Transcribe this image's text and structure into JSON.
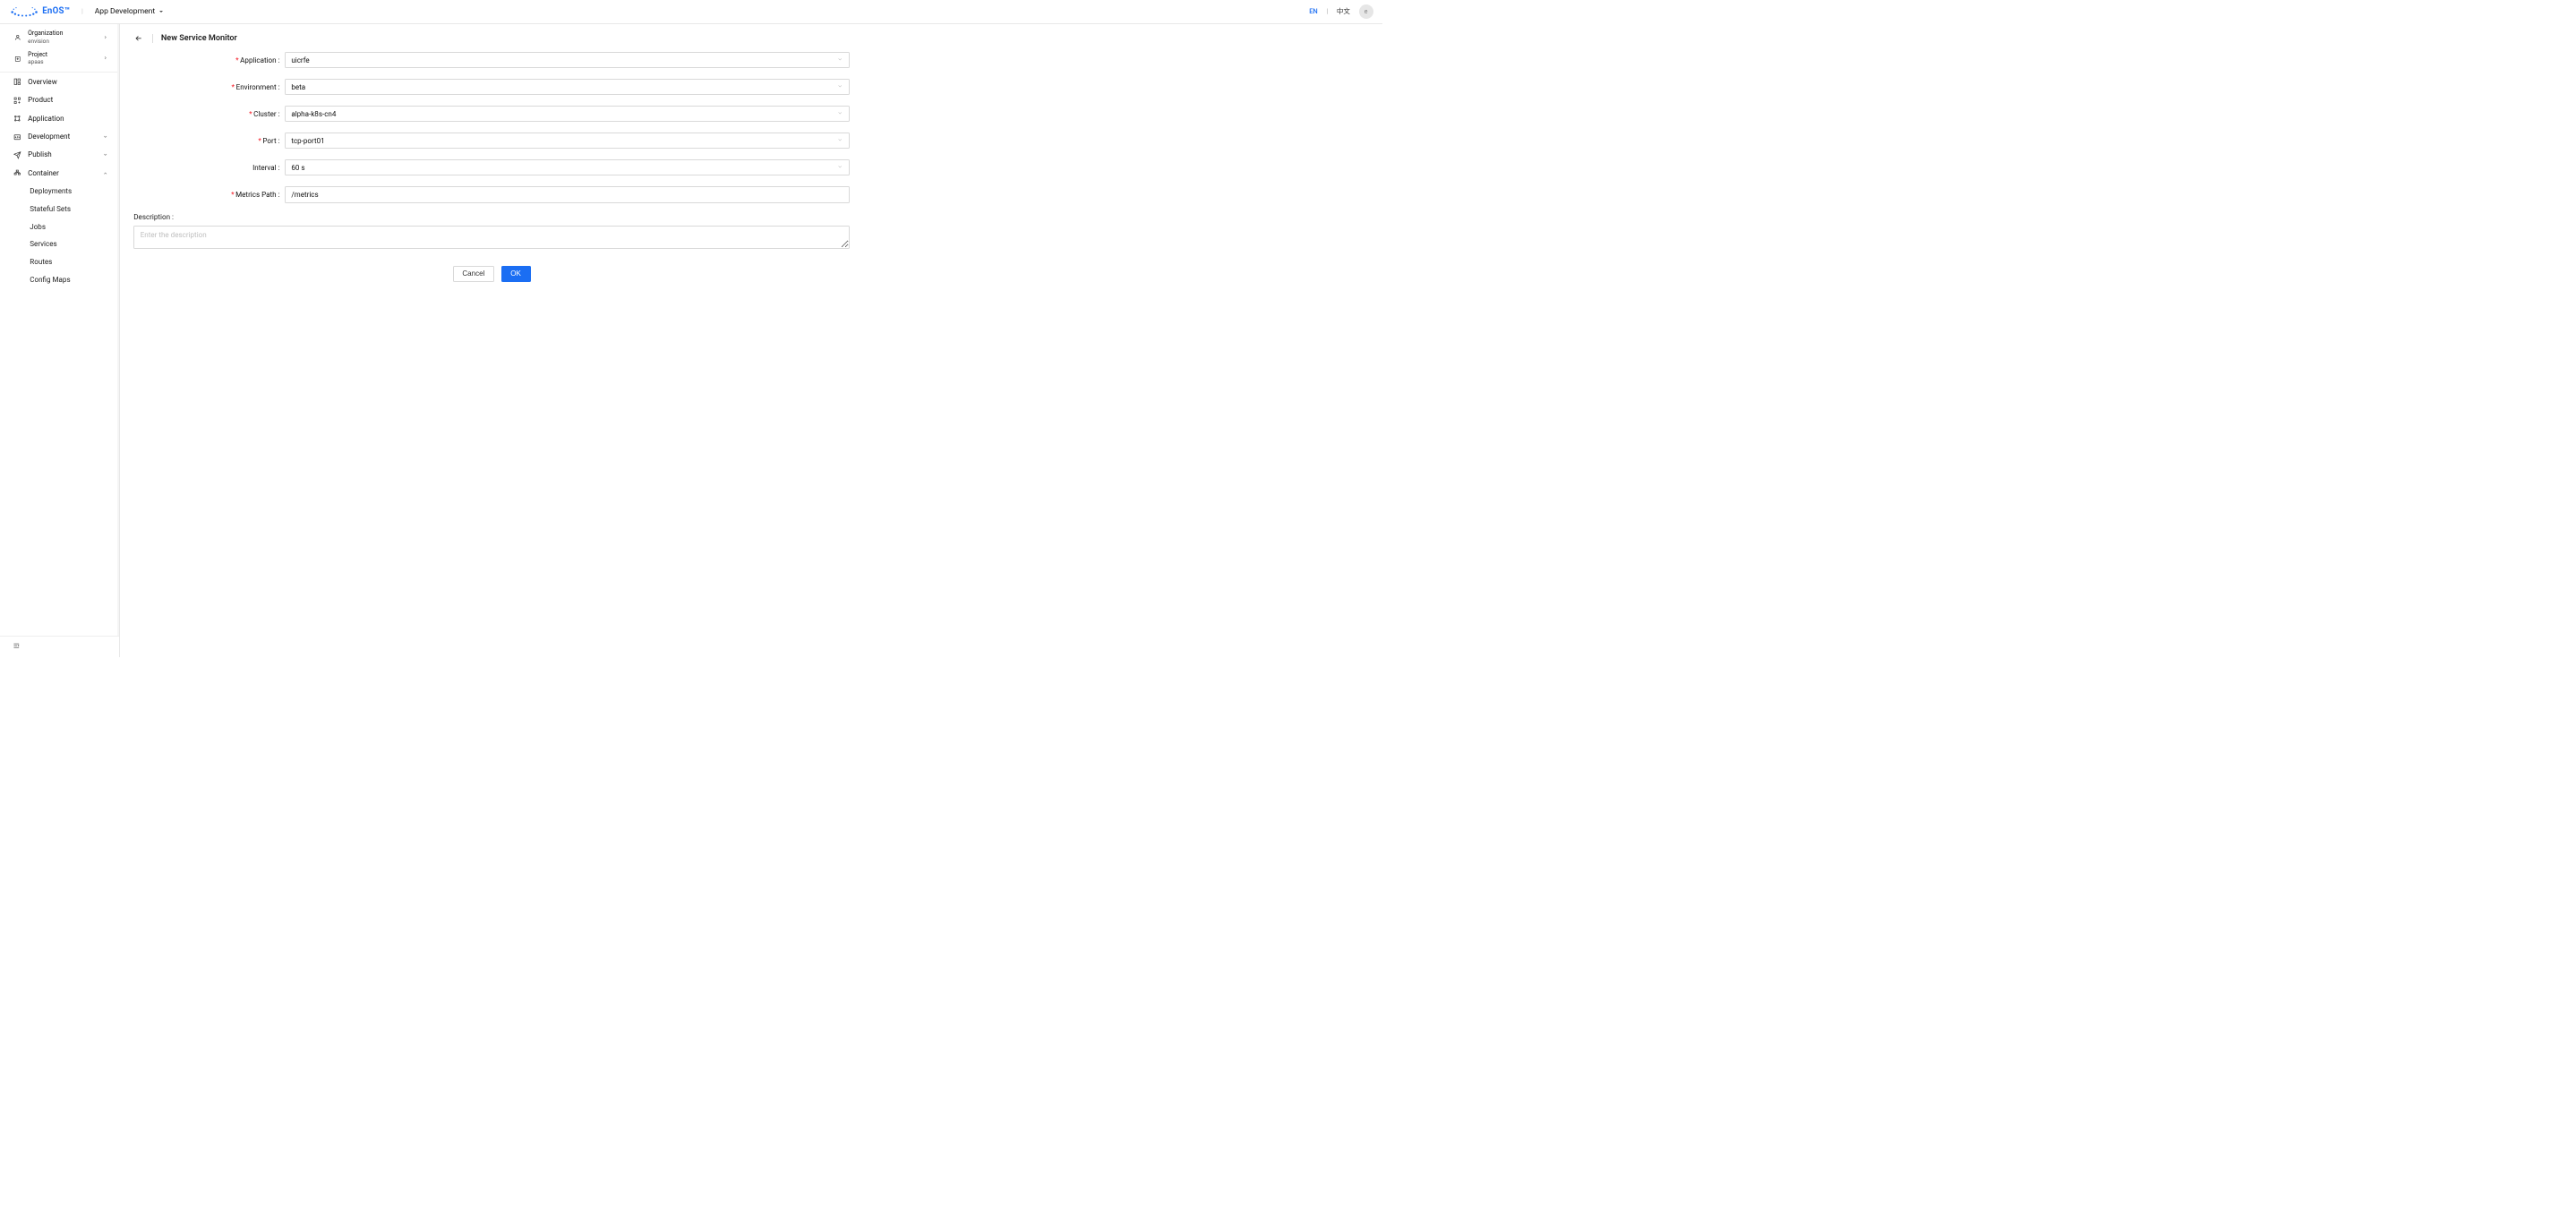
{
  "header": {
    "logo_text": "EnOS™",
    "app_switch_label": "App Development",
    "lang_en": "EN",
    "lang_sep": "|",
    "lang_zh": "中文",
    "avatar_letter": "e"
  },
  "sidebar": {
    "org": {
      "label": "Organization",
      "value": "envision"
    },
    "project": {
      "label": "Project",
      "value": "apaas"
    },
    "nav": {
      "overview": "Overview",
      "product": "Product",
      "application": "Application",
      "development": "Development",
      "publish": "Publish",
      "container": "Container"
    },
    "container_children": {
      "deployments": "Deployments",
      "stateful_sets": "Stateful Sets",
      "jobs": "Jobs",
      "services": "Services",
      "routes": "Routes",
      "config_maps": "Config Maps"
    }
  },
  "main": {
    "title": "New Service Monitor",
    "labels": {
      "application": "Application :",
      "environment": "Environment :",
      "cluster": "Cluster :",
      "port": "Port :",
      "interval": "Interval :",
      "metrics_path": "Metrics Path :",
      "description": "Description :"
    },
    "values": {
      "application": "uicrfe",
      "environment": "beta",
      "cluster": "alpha-k8s-cn4",
      "port": "tcp-port01",
      "interval": "60 s",
      "metrics_path": "/metrics"
    },
    "placeholders": {
      "description": "Enter the description"
    },
    "buttons": {
      "cancel": "Cancel",
      "ok": "OK"
    }
  }
}
